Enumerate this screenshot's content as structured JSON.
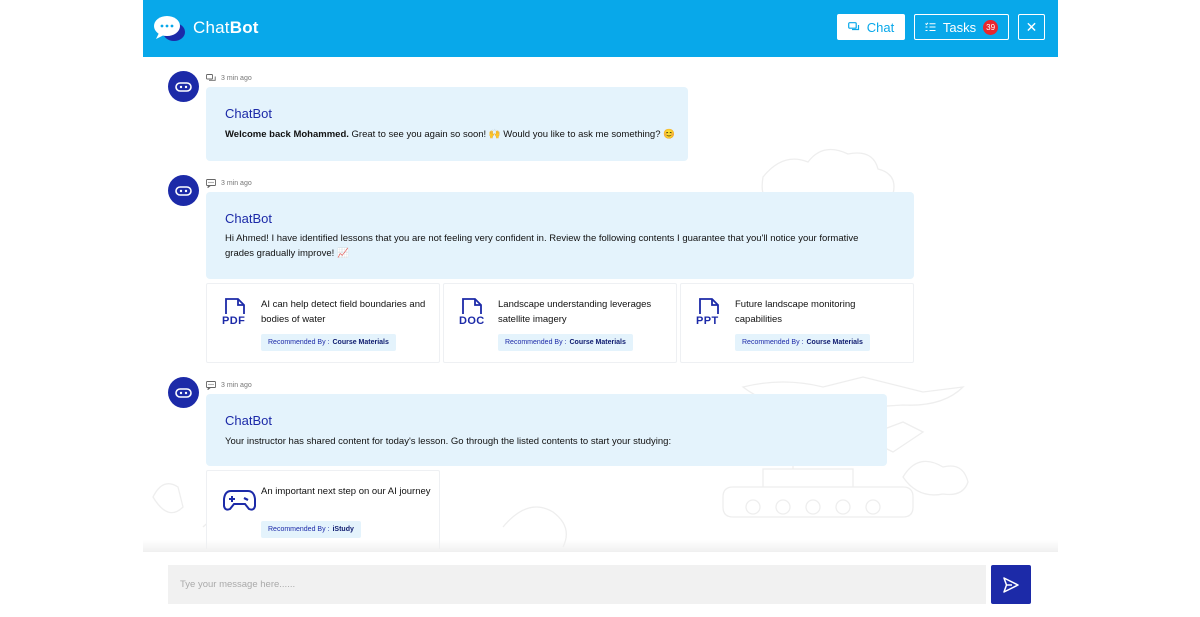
{
  "header": {
    "brand_light": "Chat",
    "brand_bold": "Bot",
    "chat_label": "Chat",
    "tasks_label": "Tasks",
    "tasks_count": "39",
    "close_label": "✕",
    "colors": {
      "header_bg": "#08a8ea",
      "accent": "#1c2aa8",
      "badge": "#e8262c"
    }
  },
  "messages": [
    {
      "time": "3 min ago",
      "sender": "ChatBot",
      "text_bold": "Welcome back Mohammed.",
      "text": " Great to see you again so soon! 🙌 Would you like to ask me something? 😊"
    },
    {
      "time": "3 min ago",
      "sender": "ChatBot",
      "text": "Hi Ahmed! I have identified lessons that you are not feeling very confident in. Review the following contents I guarantee that you'll notice your formative grades gradually improve! 📈",
      "cards": [
        {
          "type": "PDF",
          "icon": "pdf-file-icon",
          "title": "AI can help detect field boundaries and bodies of water",
          "rec_label": "Recommended By :",
          "rec_source": "Course Materials"
        },
        {
          "type": "DOC",
          "icon": "doc-file-icon",
          "title": "Landscape understanding leverages satellite imagery",
          "rec_label": "Recommended By :",
          "rec_source": "Course Materials"
        },
        {
          "type": "PPT",
          "icon": "ppt-file-icon",
          "title": "Future landscape monitoring capabilities",
          "rec_label": "Recommended By :",
          "rec_source": "Course Materials"
        }
      ]
    },
    {
      "time": "3 min ago",
      "sender": "ChatBot",
      "text": "Your instructor has shared content for today's lesson. Go through the listed contents to start your studying:",
      "cards": [
        {
          "icon": "gamepad-icon",
          "title": "An important next step on our AI journey",
          "rec_label": "Recommended By :",
          "rec_source": "iStudy"
        }
      ]
    }
  ],
  "composer": {
    "placeholder": "Tye your message here......",
    "send_icon": "send-icon"
  }
}
